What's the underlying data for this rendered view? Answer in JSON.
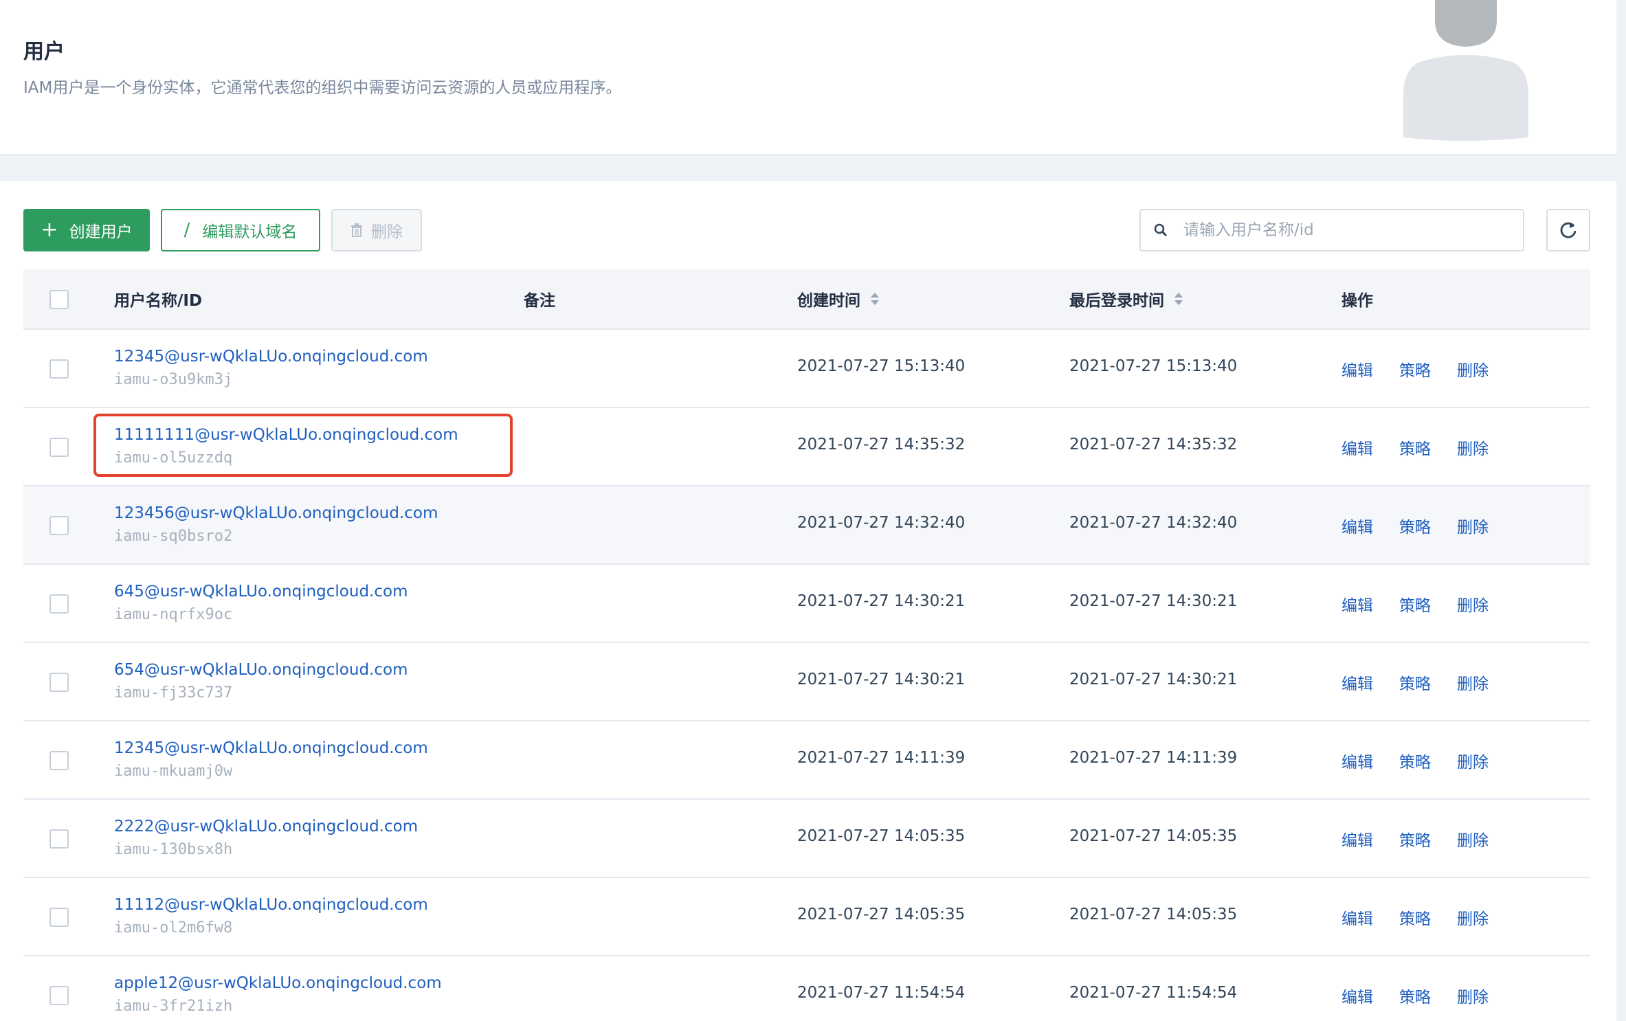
{
  "header": {
    "title": "用户",
    "description": "IAM用户是一个身份实体，它通常代表您的组织中需要访问云资源的人员或应用程序。"
  },
  "toolbar": {
    "create_label": "创建用户",
    "edit_domain_label": "编辑默认域名",
    "delete_label": "删除",
    "search_placeholder": "请输入用户名称/id"
  },
  "table": {
    "columns": {
      "name": "用户名称/ID",
      "note": "备注",
      "created": "创建时间",
      "last_login": "最后登录时间",
      "actions": "操作"
    },
    "rows": [
      {
        "name": "12345@usr-wQklaLUo.onqingcloud.com",
        "id": "iamu-o3u9km3j",
        "created": "2021-07-27 15:13:40",
        "last_login": "2021-07-27 15:13:40"
      },
      {
        "name": "11111111@usr-wQklaLUo.onqingcloud.com",
        "id": "iamu-ol5uzzdq",
        "created": "2021-07-27 14:35:32",
        "last_login": "2021-07-27 14:35:32"
      },
      {
        "name": "123456@usr-wQklaLUo.onqingcloud.com",
        "id": "iamu-sq0bsro2",
        "created": "2021-07-27 14:32:40",
        "last_login": "2021-07-27 14:32:40"
      },
      {
        "name": "645@usr-wQklaLUo.onqingcloud.com",
        "id": "iamu-nqrfx9oc",
        "created": "2021-07-27 14:30:21",
        "last_login": "2021-07-27 14:30:21"
      },
      {
        "name": "654@usr-wQklaLUo.onqingcloud.com",
        "id": "iamu-fj33c737",
        "created": "2021-07-27 14:30:21",
        "last_login": "2021-07-27 14:30:21"
      },
      {
        "name": "12345@usr-wQklaLUo.onqingcloud.com",
        "id": "iamu-mkuamj0w",
        "created": "2021-07-27 14:11:39",
        "last_login": "2021-07-27 14:11:39"
      },
      {
        "name": "2222@usr-wQklaLUo.onqingcloud.com",
        "id": "iamu-130bsx8h",
        "created": "2021-07-27 14:05:35",
        "last_login": "2021-07-27 14:05:35"
      },
      {
        "name": "11112@usr-wQklaLUo.onqingcloud.com",
        "id": "iamu-ol2m6fw8",
        "created": "2021-07-27 14:05:35",
        "last_login": "2021-07-27 14:05:35"
      },
      {
        "name": "apple12@usr-wQklaLUo.onqingcloud.com",
        "id": "iamu-3fr21izh",
        "created": "2021-07-27 11:54:54",
        "last_login": "2021-07-27 11:54:54"
      }
    ],
    "actions": {
      "edit": "编辑",
      "policy": "策略",
      "delete": "删除"
    }
  },
  "colors": {
    "primary": "#2f9c5f",
    "link": "#1f5fbf",
    "highlight": "#e0422f"
  }
}
